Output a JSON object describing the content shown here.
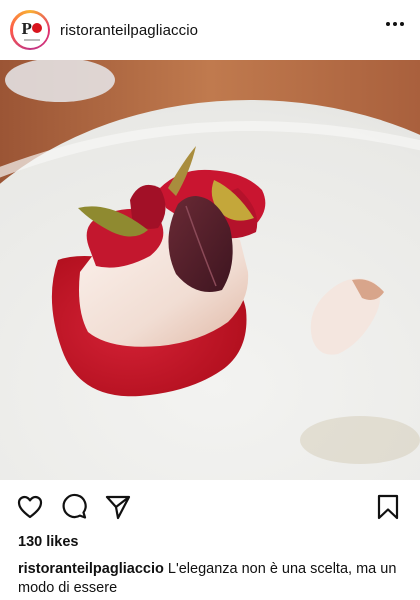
{
  "post": {
    "username": "ristoranteilpagliaccio",
    "avatar": {
      "letter": "P",
      "accent": "#d8141d"
    },
    "likes_text": "130 likes",
    "caption": {
      "username": "ristoranteilpagliaccio",
      "text": "L'eleganza non è una scelta, ma un modo di essere"
    }
  },
  "icons": {
    "more": "more-options-icon",
    "like": "heart-icon",
    "comment": "comment-bubble-icon",
    "share": "paper-plane-icon",
    "save": "bookmark-icon"
  },
  "colors": {
    "sauce": "#c8152a",
    "plate": "#ecece9",
    "table": "#b46a45",
    "text": "#111111"
  }
}
